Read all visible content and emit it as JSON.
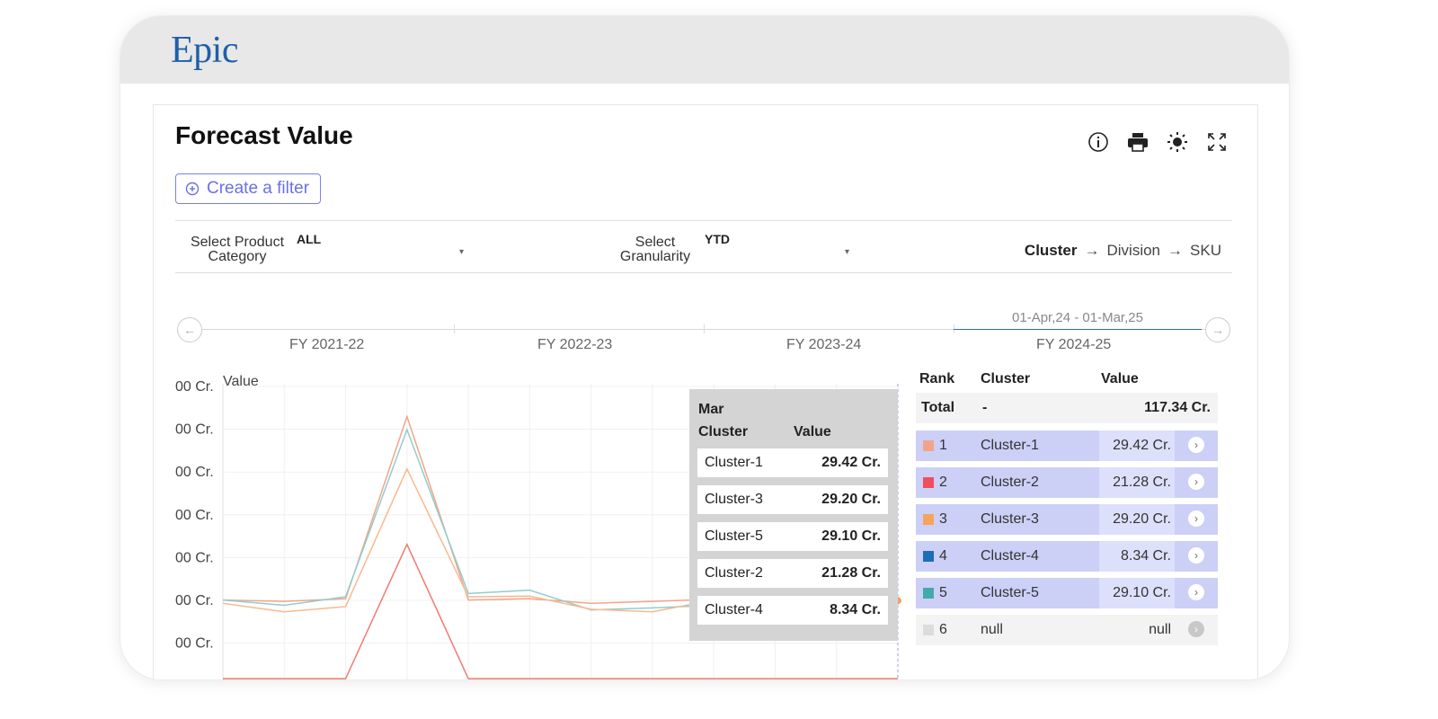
{
  "app": {
    "logo": "Epic"
  },
  "page": {
    "title": "Forecast Value"
  },
  "toolbar": {
    "icons": [
      "info-icon",
      "print-icon",
      "brightness-icon",
      "expand-icon"
    ]
  },
  "filter": {
    "create_label": "Create a filter"
  },
  "selectors": {
    "product_category": {
      "label_line1": "Select Product",
      "label_line2": "Category",
      "value": "ALL"
    },
    "granularity": {
      "label_line1": "Select",
      "label_line2": "Granularity",
      "value": "YTD"
    }
  },
  "breadcrumb": {
    "items": [
      "Cluster",
      "Division",
      "SKU"
    ]
  },
  "timeline": {
    "years": [
      "FY 2021-22",
      "FY 2022-23",
      "FY 2023-24",
      "FY 2024-25"
    ],
    "selected_range": "01-Apr,24 - 01-Mar,25"
  },
  "chart_data": {
    "type": "line",
    "ylabel": "Value",
    "ytick_labels": [
      "00 Cr.",
      "00 Cr.",
      "00 Cr.",
      "00 Cr.",
      "00 Cr.",
      "00 Cr.",
      "00 Cr."
    ],
    "colors": {
      "Cluster-1": "#f2a48a",
      "Cluster-2": "#f07a72",
      "Cluster-3": "#f8b98e",
      "Cluster-4": "#9fb8d8",
      "Cluster-5": "#93cccc"
    },
    "series": [
      {
        "name": "Cluster-1",
        "values": [
          3.0,
          2.8,
          3.2,
          31.0,
          3.0,
          3.2,
          2.5,
          2.8,
          3.1,
          2.8,
          2.7,
          2.9
        ]
      },
      {
        "name": "Cluster-5",
        "values": [
          3.0,
          2.2,
          3.5,
          29.0,
          4.0,
          4.5,
          1.5,
          1.8,
          2.2,
          2.5,
          2.0,
          2.5
        ]
      },
      {
        "name": "Cluster-3",
        "values": [
          2.5,
          1.2,
          2.0,
          23.0,
          3.5,
          3.6,
          1.6,
          1.2,
          3.0,
          3.2,
          2.4,
          2.5
        ]
      },
      {
        "name": "Cluster-2",
        "values": [
          -9.0,
          -9.0,
          -9.0,
          11.5,
          -9.0,
          -9.0,
          -9.0,
          -9.0,
          -9.0,
          -9.0,
          -9.0,
          -9.0
        ]
      }
    ]
  },
  "tooltip": {
    "month": "Mar",
    "col_cluster": "Cluster",
    "col_value": "Value",
    "rows": [
      {
        "cluster": "Cluster-1",
        "value": "29.42 Cr."
      },
      {
        "cluster": "Cluster-3",
        "value": "29.20 Cr."
      },
      {
        "cluster": "Cluster-5",
        "value": "29.10 Cr."
      },
      {
        "cluster": "Cluster-2",
        "value": "21.28 Cr."
      },
      {
        "cluster": "Cluster-4",
        "value": "8.34 Cr."
      }
    ]
  },
  "rank_table": {
    "headers": {
      "rank": "Rank",
      "cluster": "Cluster",
      "value": "Value"
    },
    "total": {
      "label": "Total",
      "cluster": "-",
      "value": "117.34 Cr."
    },
    "rows": [
      {
        "rank": "1",
        "cluster": "Cluster-1",
        "value": "29.42 Cr.",
        "color": "#f2a48a"
      },
      {
        "rank": "2",
        "cluster": "Cluster-2",
        "value": "21.28 Cr.",
        "color": "#ef4e5e"
      },
      {
        "rank": "3",
        "cluster": "Cluster-3",
        "value": "29.20 Cr.",
        "color": "#f7a35c"
      },
      {
        "rank": "4",
        "cluster": "Cluster-4",
        "value": "8.34 Cr.",
        "color": "#1e6db8"
      },
      {
        "rank": "5",
        "cluster": "Cluster-5",
        "value": "29.10 Cr.",
        "color": "#45a9a9"
      },
      {
        "rank": "6",
        "cluster": "null",
        "value": "null",
        "color": "#dcdcdc"
      }
    ]
  }
}
